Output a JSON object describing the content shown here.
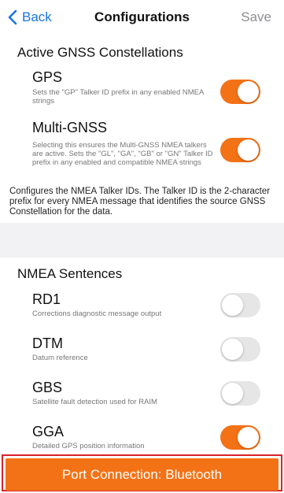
{
  "nav": {
    "back_label": "Back",
    "title": "Configurations",
    "save_label": "Save"
  },
  "gnss": {
    "header": "Active GNSS Constellations",
    "items": [
      {
        "title": "GPS",
        "subtitle": "Sets the \"GP\" Talker ID prefix in any enabled NMEA strings",
        "enabled": true
      },
      {
        "title": "Multi-GNSS",
        "subtitle": "Selecting this ensures the Multi-GNSS NMEA talkers are active.  Sets the \"GL\", \"GA\", \"GB\" or \"GN\" Talker ID prefix in any enabled and compatible NMEA strings",
        "enabled": true
      }
    ],
    "footnote": "Configures the NMEA Talker IDs. The Talker ID is the 2-character prefix for every NMEA message that identifies the source GNSS Constellation for the data."
  },
  "nmea": {
    "header": "NMEA Sentences",
    "items": [
      {
        "title": "RD1",
        "subtitle": "Corrections diagnostic message output",
        "enabled": false
      },
      {
        "title": "DTM",
        "subtitle": "Datum reference",
        "enabled": false
      },
      {
        "title": "GBS",
        "subtitle": "Satellite fault detection used for RAIM",
        "enabled": false
      },
      {
        "title": "GGA",
        "subtitle": "Detailed GPS position information",
        "enabled": true
      }
    ]
  },
  "bottom": {
    "port_label": "Port Connection: Bluetooth"
  },
  "colors": {
    "accent": "#f47216",
    "link": "#1a73e8",
    "toggle_off": "#e6e6e6",
    "frame": "#d9232a"
  }
}
